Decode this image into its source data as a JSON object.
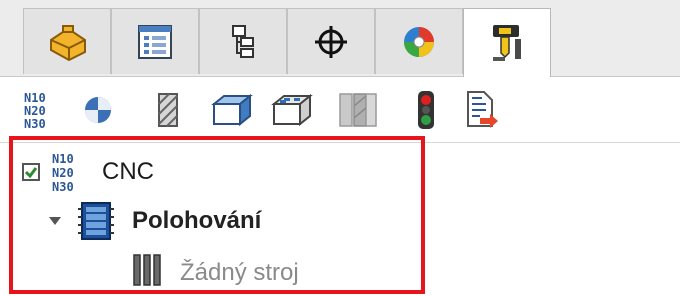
{
  "tabs": [
    {
      "icon": "part-features-icon",
      "active": false
    },
    {
      "icon": "property-list-icon",
      "active": false
    },
    {
      "icon": "configuration-tree-icon",
      "active": false
    },
    {
      "icon": "crosshair-origin-icon",
      "active": false
    },
    {
      "icon": "appearance-color-icon",
      "active": false
    },
    {
      "icon": "cam-manager-icon",
      "active": true
    }
  ],
  "toolbar": {
    "items": [
      {
        "icon": "nc-program-icon",
        "text": "N10 N20 N30"
      },
      {
        "icon": "sphere-icon"
      },
      {
        "icon": "hatched-block-icon"
      },
      {
        "icon": "solid-box-icon"
      },
      {
        "icon": "pocket-features-icon"
      },
      {
        "icon": "gray-blocks-icon"
      },
      {
        "icon": "traffic-light-icon"
      },
      {
        "icon": "export-document-icon"
      }
    ]
  },
  "tree": {
    "root": {
      "label": "CNC",
      "icon_text": "N10 N20 N30",
      "checked": true
    },
    "child": {
      "label": "Polohování",
      "expanded": true
    },
    "grandchild": {
      "label": "Žádný stroj"
    }
  },
  "colors": {
    "highlight": "#e8141c",
    "check": "#2e8b2e",
    "nc_blue": "#2b5797",
    "machine_blue": "#1e4f9a"
  }
}
